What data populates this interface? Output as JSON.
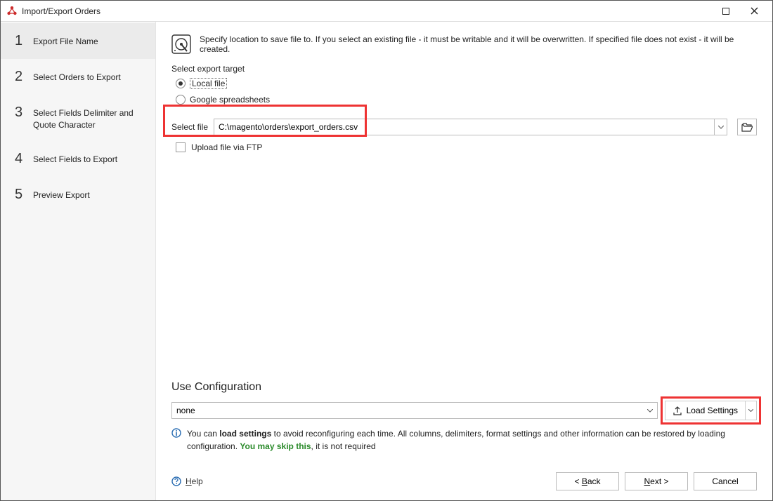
{
  "window": {
    "title": "Import/Export Orders"
  },
  "sidebar": {
    "steps": [
      {
        "num": "1",
        "label": "Export File Name"
      },
      {
        "num": "2",
        "label": "Select Orders to Export"
      },
      {
        "num": "3",
        "label": "Select Fields Delimiter and Quote Character"
      },
      {
        "num": "4",
        "label": "Select Fields to Export"
      },
      {
        "num": "5",
        "label": "Preview Export"
      }
    ]
  },
  "main": {
    "info": "Specify location to save file to. If you select an existing file - it must be writable and it will be overwritten. If specified file does not exist - it will be created.",
    "target_label": "Select export target",
    "radio_local": "Local file",
    "radio_google": "Google spreadsheets",
    "file_label": "Select file",
    "file_value": "C:\\magento\\orders\\export_orders.csv",
    "upload_ftp": "Upload file via FTP"
  },
  "config": {
    "title": "Use Configuration",
    "selected": "none",
    "load_btn": "Load Settings",
    "hint_pre": "You can ",
    "hint_bold": "load settings",
    "hint_mid": " to avoid reconfiguring each time. All columns, delimiters, format settings and other information can be restored by loading configuration. ",
    "hint_green": "You may skip this",
    "hint_post": ", it is not required"
  },
  "footer": {
    "help": "Help",
    "back": "< Back",
    "next": "Next >",
    "cancel": "Cancel"
  }
}
